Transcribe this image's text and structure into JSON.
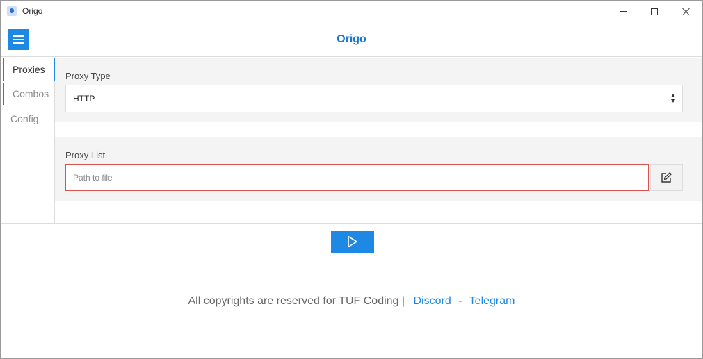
{
  "window": {
    "title": "Origo",
    "app_icon": "origo-logo-icon",
    "controls": [
      "minimize-icon",
      "maximize-icon",
      "close-icon"
    ]
  },
  "header": {
    "menu_icon": "hamburger-menu-icon",
    "title": "Origo",
    "accent_color": "#1e88e5"
  },
  "sidebar": {
    "items": [
      {
        "label": "Proxies",
        "active": true
      },
      {
        "label": "Combos",
        "active": false
      },
      {
        "label": "Config",
        "active": false
      }
    ]
  },
  "proxy_type": {
    "label": "Proxy Type",
    "selected": "HTTP"
  },
  "proxy_list": {
    "label": "Proxy List",
    "value": "",
    "placeholder": "Path to file",
    "edit_icon": "edit-icon",
    "error_border_color": "#d9534f"
  },
  "run": {
    "icon": "play-icon"
  },
  "footer": {
    "text": "All copyrights are reserved for TUF Coding |",
    "discord": "Discord",
    "separator": "-",
    "telegram": "Telegram"
  }
}
